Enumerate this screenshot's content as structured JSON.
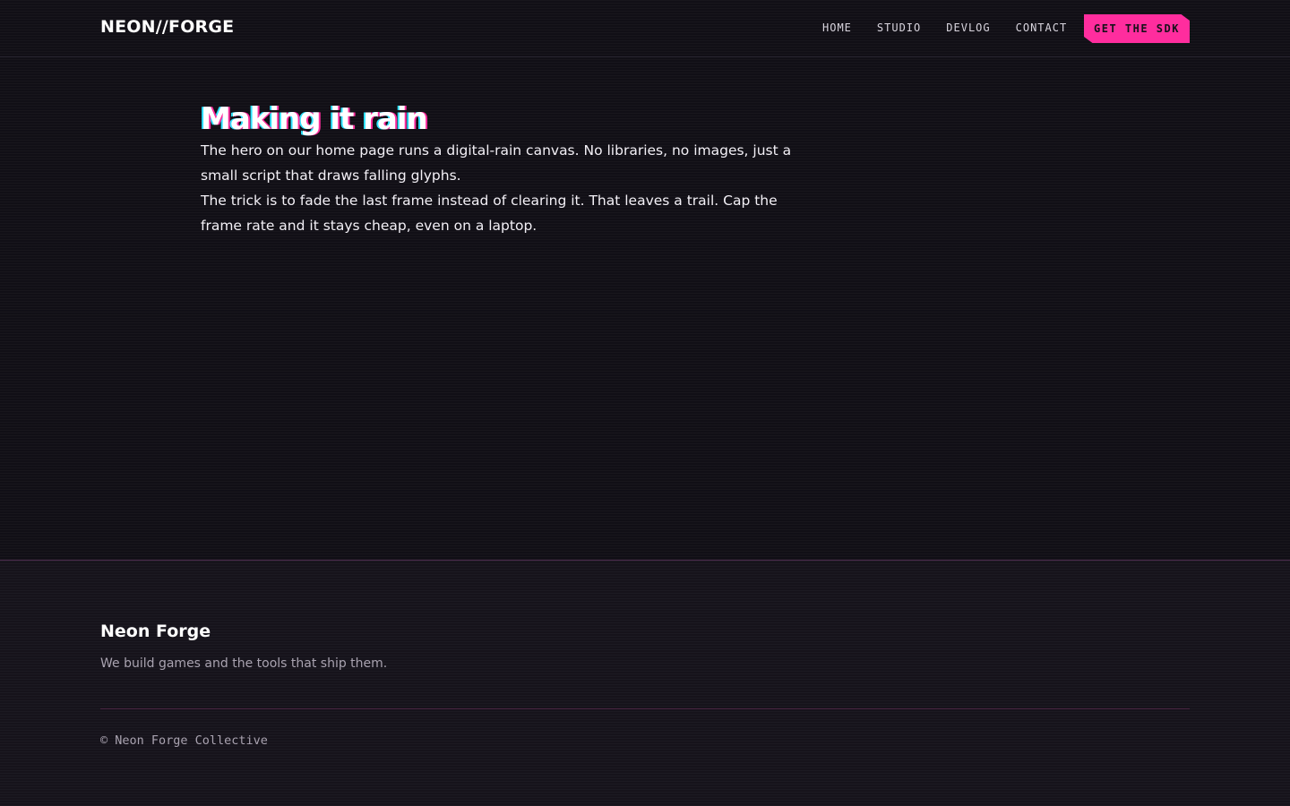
{
  "header": {
    "brand": "NEON//FORGE",
    "nav": [
      {
        "label": "HOME"
      },
      {
        "label": "STUDIO"
      },
      {
        "label": "DEVLOG"
      },
      {
        "label": "CONTACT"
      }
    ],
    "cta_label": "GET THE SDK"
  },
  "article": {
    "title": "Making it rain",
    "paragraphs": [
      "The hero on our home page runs a digital-rain canvas. No libraries, no images, just a small script that draws falling glyphs.",
      "The trick is to fade the last frame instead of clearing it. That leaves a trail. Cap the frame rate and it stays cheap, even on a laptop."
    ]
  },
  "footer": {
    "brand": "Neon Forge",
    "tagline": "We build games and the tools that ship them.",
    "copyright": "© Neon Forge Collective"
  },
  "colors": {
    "background": "#131118",
    "accent": "#ff2d9e",
    "accent_alt": "#2de2ff",
    "text": "#f2eff5",
    "muted": "#a9a3b0"
  }
}
